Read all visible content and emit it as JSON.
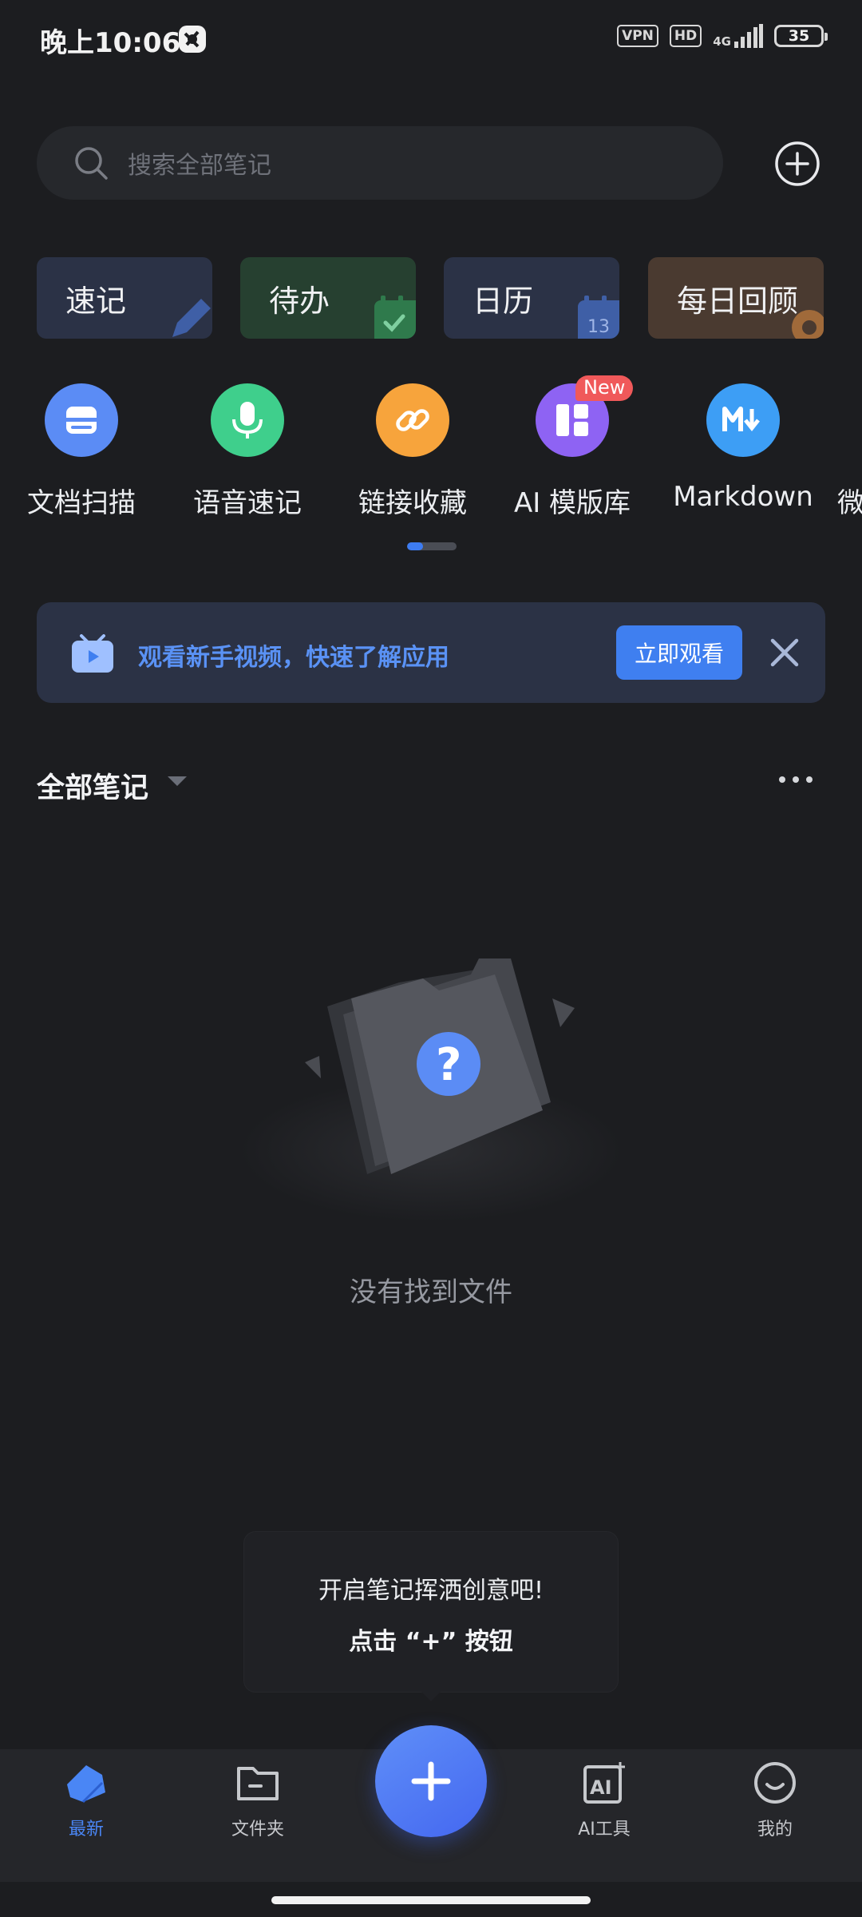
{
  "status_bar": {
    "time": "晚上10:06",
    "vpn": "VPN",
    "hd": "HD",
    "network": "4G",
    "battery": "35"
  },
  "search": {
    "placeholder": "搜索全部笔记"
  },
  "quick_cards": [
    {
      "label": "速记",
      "bg": "#2b3246",
      "accent": "#3f5fa6"
    },
    {
      "label": "待办",
      "bg": "#264030",
      "accent": "#2f7a4c"
    },
    {
      "label": "日历",
      "bg": "#2b3246",
      "accent": "#3f5fa6",
      "deco": "13"
    },
    {
      "label": "每日回顾",
      "bg": "#4a3a30",
      "accent": "#a06a3a"
    }
  ],
  "tools": [
    {
      "label": "文档扫描",
      "icon": "scan-icon",
      "color": "#5b8cf5"
    },
    {
      "label": "语音速记",
      "icon": "microphone-icon",
      "color": "#3fcf8c"
    },
    {
      "label": "链接收藏",
      "icon": "link-icon",
      "color": "#f7a43c"
    },
    {
      "label": "AI 模版库",
      "icon": "template-icon",
      "color": "#8e63f3",
      "badge": "New"
    },
    {
      "label": "Markdown",
      "icon": "markdown-icon",
      "color": "#3d9ef5"
    },
    {
      "label": "微",
      "icon": "partial-icon"
    }
  ],
  "banner": {
    "text": "观看新手视频，快速了解应用",
    "button": "立即观看"
  },
  "notes": {
    "title": "全部笔记"
  },
  "empty": {
    "text": "没有找到文件"
  },
  "tooltip": {
    "line1": "开启笔记挥洒创意吧!",
    "line2": "点击 “+” 按钮"
  },
  "nav": {
    "items": [
      {
        "label": "最新",
        "active": true
      },
      {
        "label": "文件夹"
      },
      {
        "label": "AI工具"
      },
      {
        "label": "我的"
      }
    ],
    "active_color": "#4a86f5"
  }
}
